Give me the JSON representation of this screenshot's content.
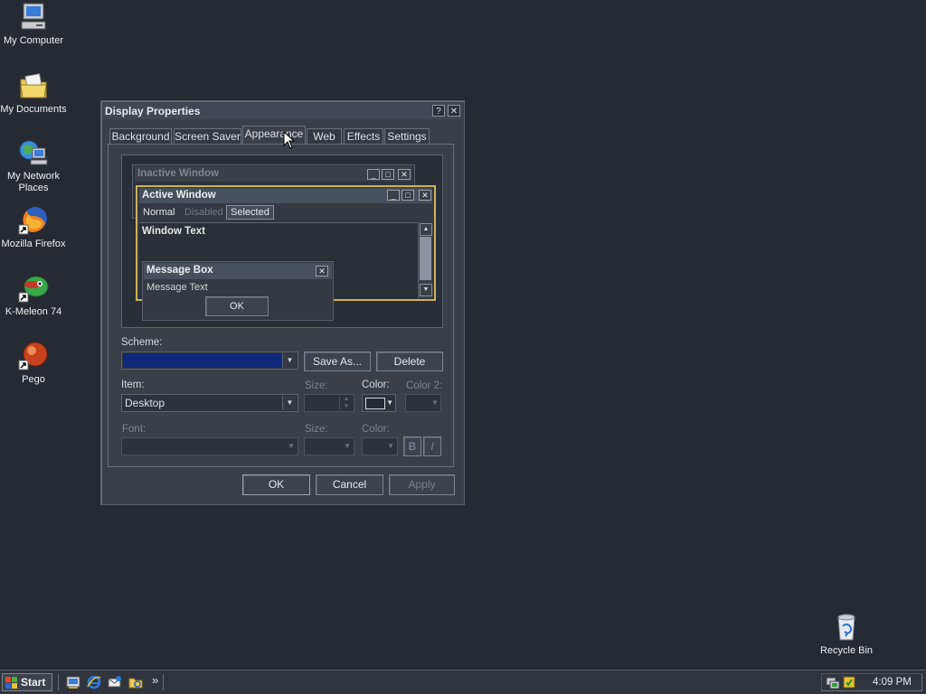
{
  "desktop": {
    "icons": [
      {
        "label": "My Computer"
      },
      {
        "label": "My Documents"
      },
      {
        "label": "My Network Places"
      },
      {
        "label": "Mozilla Firefox"
      },
      {
        "label": "K-Meleon 74"
      },
      {
        "label": "Pego"
      },
      {
        "label": "Recycle Bin"
      }
    ]
  },
  "dialog": {
    "title": "Display Properties",
    "help_label": "?",
    "close_label": "✕",
    "tabs": [
      {
        "label": "Background"
      },
      {
        "label": "Screen Saver"
      },
      {
        "label": "Appearance"
      },
      {
        "label": "Web"
      },
      {
        "label": "Effects"
      },
      {
        "label": "Settings"
      }
    ],
    "selected_tab": "Appearance",
    "preview": {
      "inactive_title": "Inactive Window",
      "active_title": "Active Window",
      "menu": [
        "Normal",
        "Disabled",
        "Selected"
      ],
      "window_text": "Window Text",
      "message_title": "Message Box",
      "message_text": "Message Text",
      "ok_label": "OK"
    },
    "scheme_label": "Scheme:",
    "save_as_label": "Save As...",
    "delete_label": "Delete",
    "item_label": "Item:",
    "item_value": "Desktop",
    "size_label": "Size:",
    "color_label": "Color:",
    "color2_label": "Color 2:",
    "font_label": "Font:",
    "font_size_label": "Size:",
    "font_color_label": "Color:",
    "bold_label": "B",
    "italic_label": "I",
    "ok_label": "OK",
    "cancel_label": "Cancel",
    "apply_label": "Apply"
  },
  "taskbar": {
    "start_label": "Start",
    "chevron_label": "»",
    "clock": "4:09 PM"
  },
  "colors": {
    "desktop": "#262a32",
    "scheme_selected": "#10297a",
    "active_border": "#c9b35a"
  }
}
